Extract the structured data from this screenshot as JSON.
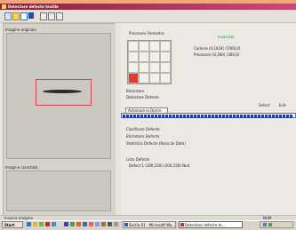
{
  "window": {
    "title": "Detectare defecte textile"
  },
  "left": {
    "raw_label": "Imagine originala",
    "processed_label": "Imagine corectata"
  },
  "right": {
    "processing_title": "Procesare Fereastra",
    "loaded_status": "Incarcata",
    "camera_text": "Camera (0,1024) (1560,0)",
    "processing_text": "Procesare (0,300) (300,0)",
    "binarize": "Binarizare",
    "detect": "Detectare Defecte",
    "stop_button": "Actionare la Oprire",
    "select_button": "Select",
    "exit_button": "Exit",
    "classify": "Clasificare Defecte",
    "labeling": "Etichetare Defecte",
    "stats": "Statistica Defecte (Baza de Date)",
    "list_title": "Lista Defecte",
    "defect_row": "Defect 1     (100,150)  (200,150)     Nod"
  },
  "status": {
    "left": "Incarca imagine",
    "right": "NUM"
  },
  "taskbar": {
    "start": "Start",
    "task1": "Sectia 01 - Microsoft Wo...",
    "task2": "Detectare defecte te..."
  }
}
